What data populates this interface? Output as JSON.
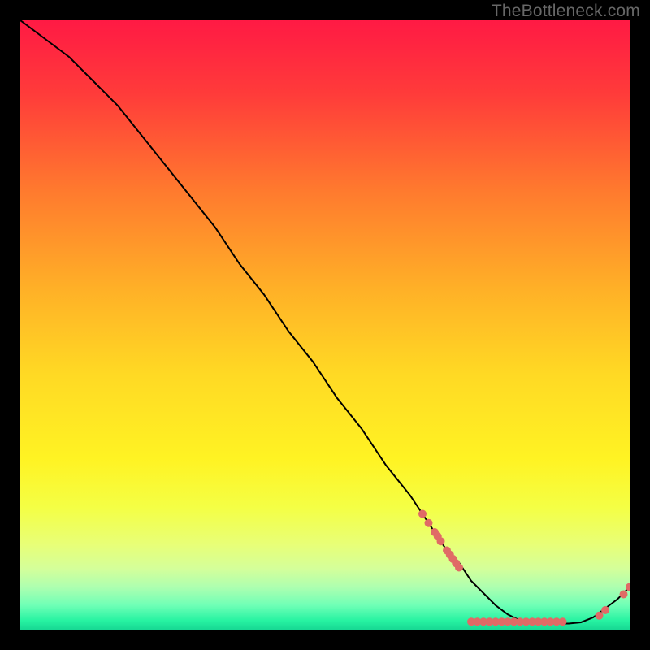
{
  "watermark": "TheBottleneck.com",
  "chart_data": {
    "type": "line",
    "title": "",
    "xlabel": "",
    "ylabel": "",
    "xlim": [
      0,
      100
    ],
    "ylim": [
      0,
      100
    ],
    "curve": {
      "x": [
        0,
        4,
        8,
        12,
        16,
        20,
        24,
        28,
        32,
        36,
        40,
        44,
        48,
        52,
        56,
        60,
        64,
        68,
        70,
        72,
        74,
        76,
        78,
        80,
        82,
        84,
        86,
        88,
        90,
        92,
        94,
        96,
        98,
        100
      ],
      "y": [
        100,
        97,
        94,
        90,
        86,
        81,
        76,
        71,
        66,
        60,
        55,
        49,
        44,
        38,
        33,
        27,
        22,
        16,
        13,
        11,
        8,
        6,
        4,
        2.5,
        1.5,
        1,
        1,
        1,
        1,
        1.2,
        2,
        3.5,
        5,
        7
      ]
    },
    "scatter": {
      "x": [
        66,
        67,
        68,
        68.5,
        69,
        70,
        70.5,
        71,
        71.5,
        72,
        74,
        75,
        76,
        77,
        78,
        79,
        80,
        81,
        82,
        83,
        84,
        85,
        86,
        87,
        88,
        89,
        95,
        96,
        99,
        100
      ],
      "y": [
        19,
        17.5,
        16,
        15.3,
        14.5,
        13,
        12.3,
        11.6,
        10.9,
        10.2,
        1.3,
        1.3,
        1.3,
        1.3,
        1.3,
        1.3,
        1.3,
        1.3,
        1.3,
        1.3,
        1.3,
        1.3,
        1.3,
        1.3,
        1.3,
        1.3,
        2.3,
        3.2,
        5.8,
        7
      ]
    },
    "gradient_stops": [
      {
        "offset": 0.0,
        "color": "#ff1a44"
      },
      {
        "offset": 0.12,
        "color": "#ff3b3a"
      },
      {
        "offset": 0.28,
        "color": "#ff7a2e"
      },
      {
        "offset": 0.44,
        "color": "#ffb027"
      },
      {
        "offset": 0.58,
        "color": "#ffd924"
      },
      {
        "offset": 0.72,
        "color": "#fff323"
      },
      {
        "offset": 0.8,
        "color": "#f4ff45"
      },
      {
        "offset": 0.86,
        "color": "#e8ff77"
      },
      {
        "offset": 0.9,
        "color": "#d4ff9a"
      },
      {
        "offset": 0.93,
        "color": "#aeffb0"
      },
      {
        "offset": 0.96,
        "color": "#6fffb6"
      },
      {
        "offset": 0.985,
        "color": "#27f3a2"
      },
      {
        "offset": 1.0,
        "color": "#17d893"
      }
    ],
    "dot_color": "#e06a66",
    "line_color": "#000000"
  }
}
